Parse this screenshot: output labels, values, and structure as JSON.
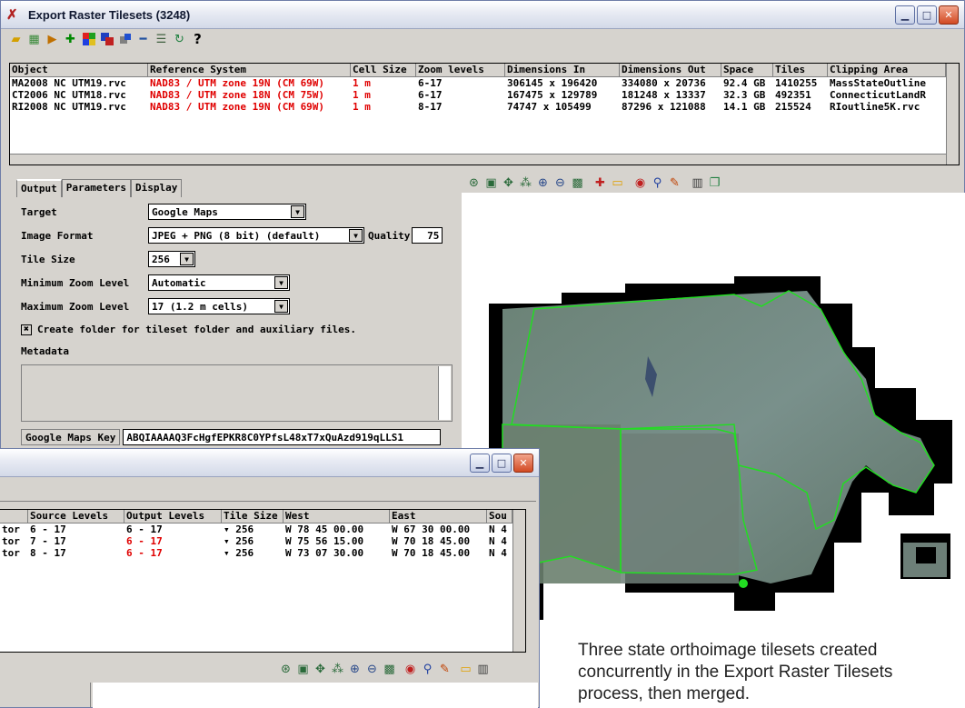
{
  "main_window": {
    "title": "Export Raster Tilesets (3248)",
    "toolbar_icons": [
      "open-folder-icon",
      "add-objects-icon",
      "run-icon",
      "add-icon",
      "color-grid-icon",
      "multi-raster-icon",
      "remove-raster-icon",
      "minus-icon",
      "list-icon",
      "refresh-icon",
      "help-icon"
    ],
    "help_label": "?",
    "table": {
      "columns": [
        "Object",
        "Reference System",
        "Cell Size",
        "Zoom levels",
        "Dimensions In",
        "Dimensions Out",
        "Space",
        "Tiles",
        "Clipping Area"
      ],
      "rows": [
        {
          "object": "MA2008 NC UTM19.rvc",
          "ref": "NAD83 / UTM zone 19N (CM 69W)",
          "cell": "1 m",
          "zoom": "6-17",
          "dim_in": "306145 x 196420",
          "dim_out": "334080 x 20736",
          "space": "92.4 GB",
          "tiles": "1410255",
          "clip": "MassStateOutline"
        },
        {
          "object": "CT2006 NC UTM18.rvc",
          "ref": "NAD83 / UTM zone 18N (CM 75W)",
          "cell": "1 m",
          "zoom": "6-17",
          "dim_in": "167475 x 129789",
          "dim_out": "181248 x 13337",
          "space": "32.3 GB",
          "tiles": "492351",
          "clip": "ConnecticutLandR"
        },
        {
          "object": "RI2008 NC UTM19.rvc",
          "ref": "NAD83 / UTM zone 19N (CM 69W)",
          "cell": "1 m",
          "zoom": "8-17",
          "dim_in": "74747 x 105499",
          "dim_out": "87296 x 121088",
          "space": "14.1 GB",
          "tiles": "215524",
          "clip": "RIoutline5K.rvc"
        }
      ]
    },
    "tabs": [
      "Output",
      "Parameters",
      "Display"
    ],
    "form": {
      "target_label": "Target",
      "target_value": "Google Maps",
      "image_format_label": "Image Format",
      "image_format_value": "JPEG + PNG (8 bit) (default)",
      "quality_label": "Quality",
      "quality_value": "75",
      "tile_size_label": "Tile Size",
      "tile_size_value": "256",
      "min_zoom_label": "Minimum Zoom Level",
      "min_zoom_value": "Automatic",
      "max_zoom_label": "Maximum Zoom Level",
      "max_zoom_value": "17 (1.2 m cells)",
      "create_folder_label": "Create folder for tileset folder and auxiliary files.",
      "create_folder_checked": true,
      "metadata_label": "Metadata",
      "maps_key_label": "Google Maps Key",
      "maps_key_value": "ABQIAAAAQ3FcHgfEPKR8C0YPfsL48xT7xQuAzd919qLLS1"
    }
  },
  "secondary_window": {
    "table": {
      "columns": [
        "Source Levels",
        "Output Levels",
        "Tile Size",
        "West",
        "East",
        "Sou"
      ],
      "rows": [
        {
          "prefix": "tor",
          "src": "6 - 17",
          "out": "6 - 17",
          "out_red": false,
          "tile": "256",
          "west": "W 78 45 00.00",
          "east": "W 67 30 00.00",
          "south": "N 4"
        },
        {
          "prefix": "tor",
          "src": "7 - 17",
          "out": "6 - 17",
          "out_red": true,
          "tile": "256",
          "west": "W 75 56 15.00",
          "east": "W 70 18 45.00",
          "south": "N 4"
        },
        {
          "prefix": "tor",
          "src": "8 - 17",
          "out": "6 - 17",
          "out_red": true,
          "tile": "256",
          "west": "W 73 07 30.00",
          "east": "W 70 18 45.00",
          "south": "N 4"
        }
      ]
    }
  },
  "caption": {
    "line1": "Three state orthoimage tilesets created",
    "line2": "concurrently in the Export Raster Tilesets",
    "line3": "process, then merged."
  },
  "colors": {
    "accent_red": "#e00000",
    "boundary_green": "#22dd22",
    "panel_gray": "#d6d3ce"
  }
}
